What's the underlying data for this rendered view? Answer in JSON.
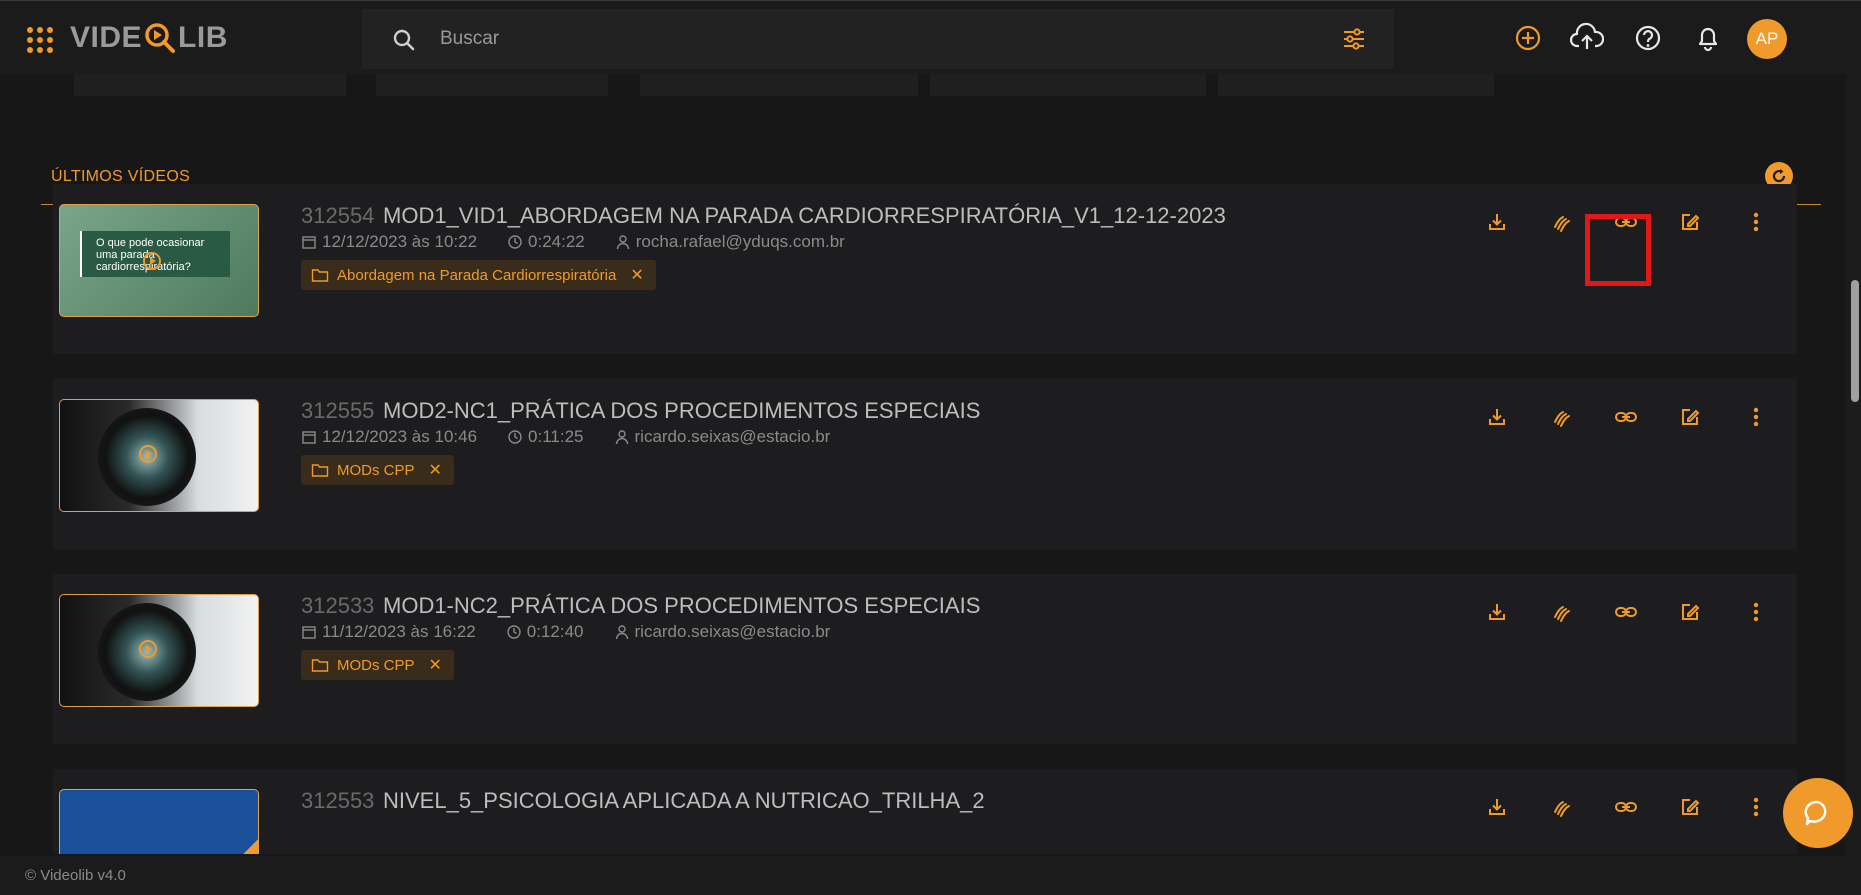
{
  "header": {
    "logo_left": "VIDE",
    "logo_right": "LIB",
    "search_placeholder": "Buscar"
  },
  "section": {
    "title": "ÚLTIMOS VÍDEOS"
  },
  "videos": [
    {
      "id": "312554",
      "title": "MOD1_VID1_ABORDAGEM NA PARADA CARDIORRESPIRATÓRIA_V1_12-12-2023",
      "date": "12/12/2023 às 10:22",
      "duration": "0:24:22",
      "author": "rocha.rafael@yduqs.com.br",
      "tag": "Abordagem na Parada Cardiorrespiratória",
      "thumb_text": "O que pode ocasionar uma parada cardiorrespiratória?"
    },
    {
      "id": "312555",
      "title": "MOD2-NC1_PRÁTICA DOS PROCEDIMENTOS ESPECIAIS",
      "date": "12/12/2023 às 10:46",
      "duration": "0:11:25",
      "author": "ricardo.seixas@estacio.br",
      "tag": "MODs CPP"
    },
    {
      "id": "312533",
      "title": "MOD1-NC2_PRÁTICA DOS PROCEDIMENTOS ESPECIAIS",
      "date": "11/12/2023 às 16:22",
      "duration": "0:12:40",
      "author": "ricardo.seixas@estacio.br",
      "tag": "MODs CPP"
    },
    {
      "id": "312553",
      "title": "NIVEL_5_PSICOLOGIA APLICADA A NUTRICAO_TRILHA_2"
    }
  ],
  "user": {
    "initials": "AP"
  },
  "footer": {
    "text": "© Videolib v4.0"
  },
  "colors": {
    "accent": "#f09a2b",
    "background": "#171717",
    "highlight": "#e01818"
  }
}
